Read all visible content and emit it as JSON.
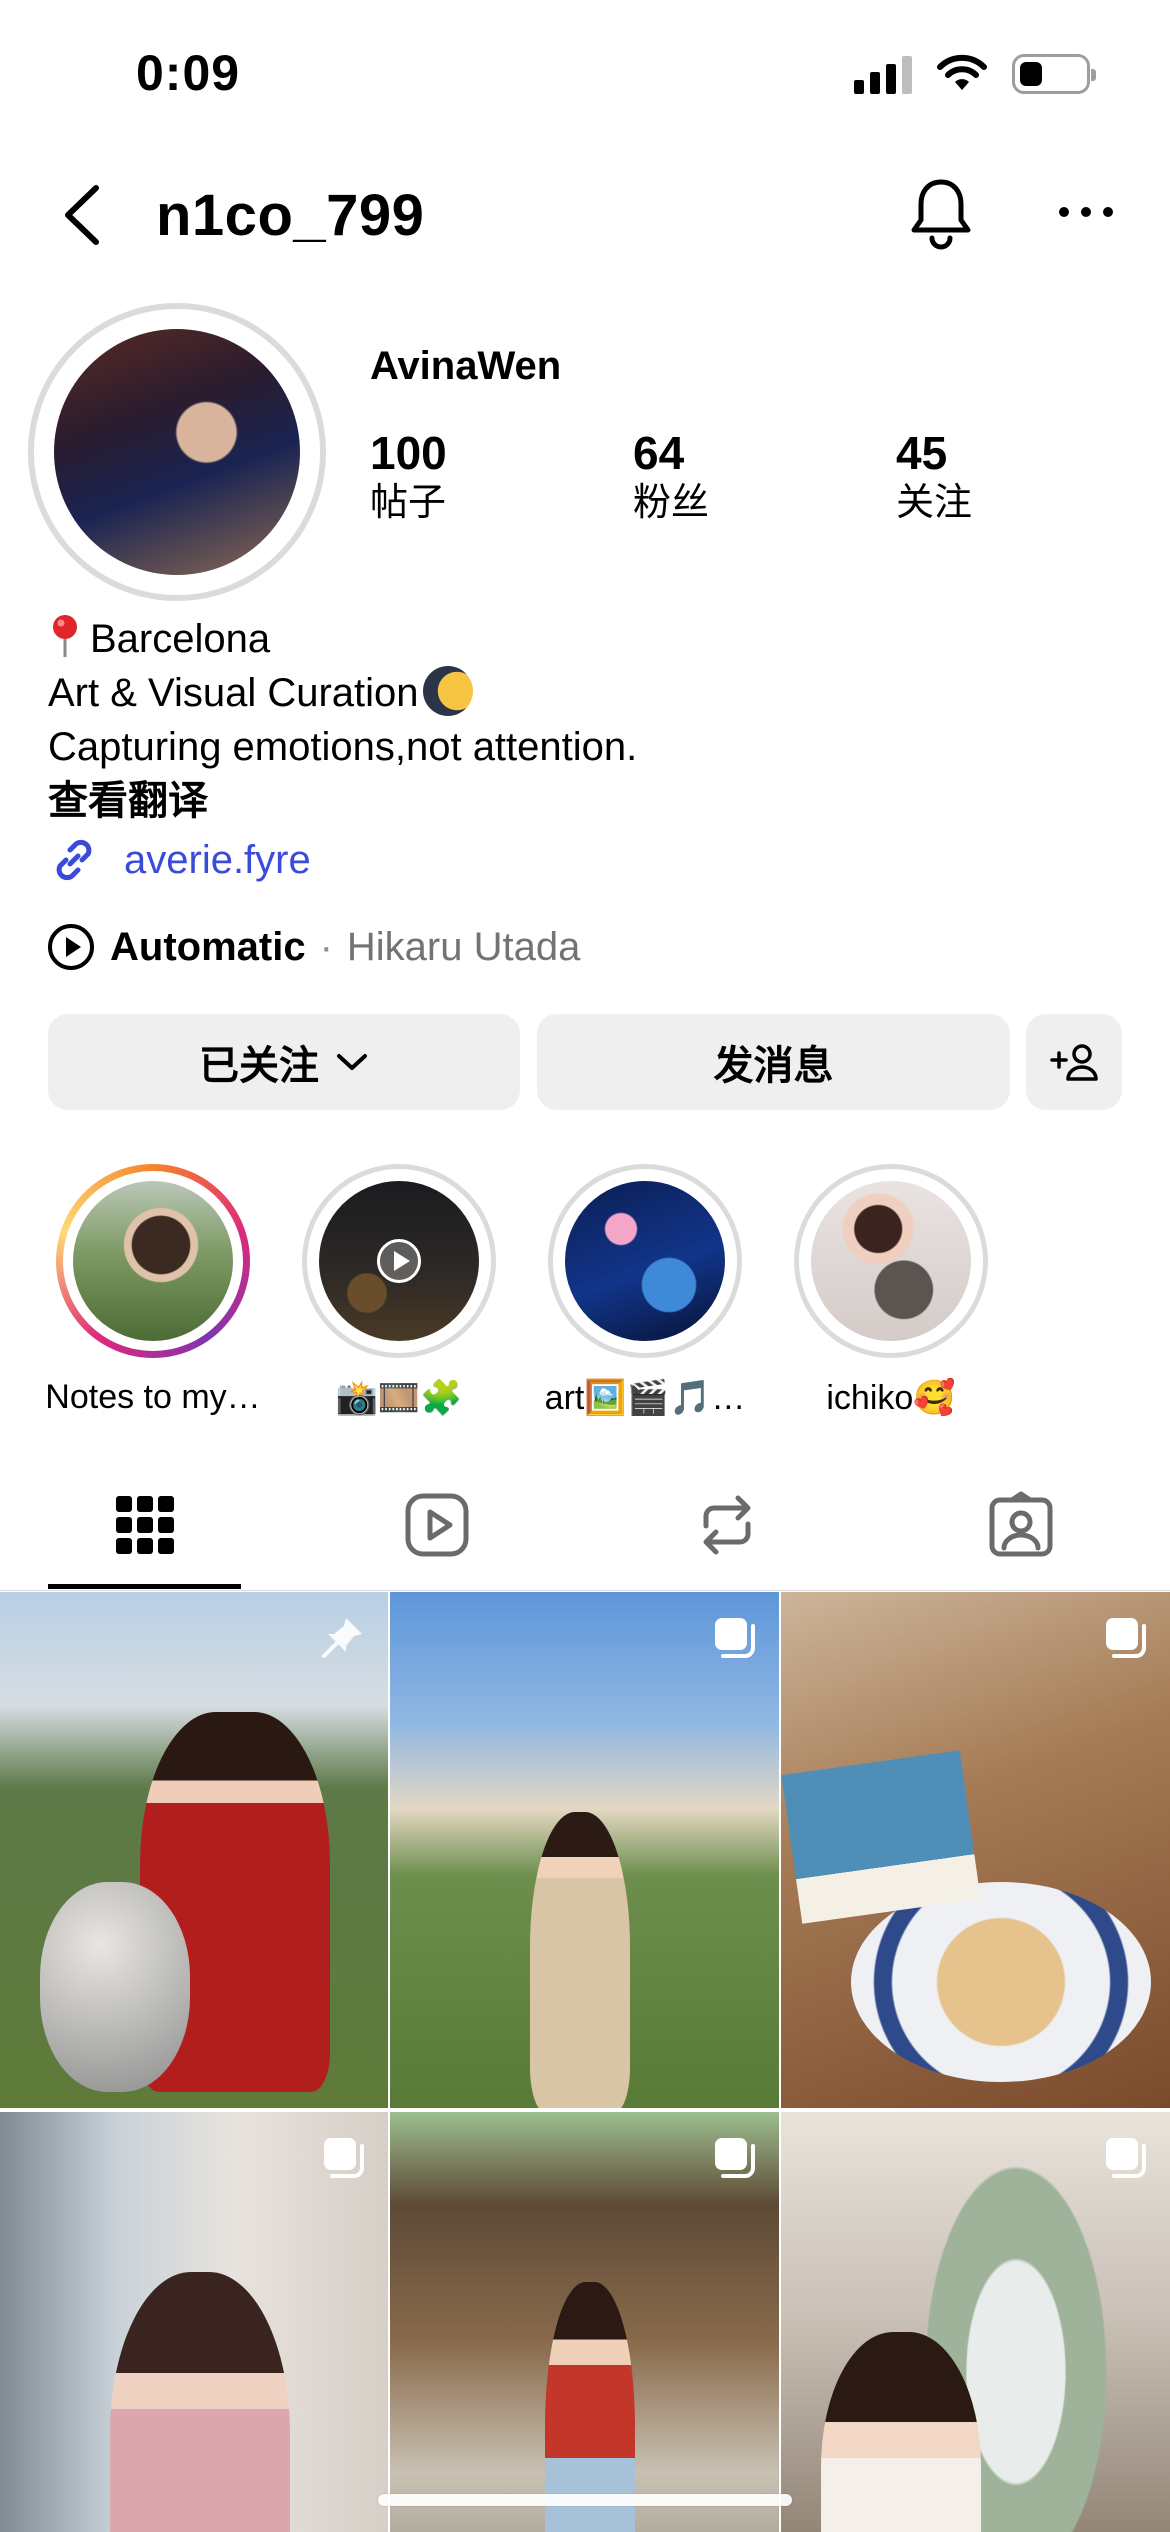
{
  "status_bar": {
    "time": "0:09"
  },
  "header": {
    "username": "n1co_799"
  },
  "profile": {
    "display_name": "AvinaWen",
    "stats": [
      {
        "value": "100",
        "label": "帖子"
      },
      {
        "value": "64",
        "label": "粉丝"
      },
      {
        "value": "45",
        "label": "关注"
      }
    ],
    "bio": {
      "location": "Barcelona",
      "line2": "Art & Visual Curation",
      "line3": "Capturing emotions,not attention.",
      "translate": "查看翻译"
    },
    "link": "averie.fyre",
    "music": {
      "title": "Automatic",
      "separator": "·",
      "artist": "Hikaru Utada"
    }
  },
  "actions": {
    "following_label": "已关注",
    "message_label": "发消息"
  },
  "highlights": [
    {
      "label": "Notes to my…",
      "style": "story"
    },
    {
      "label": "📸🎞️🧩"
    },
    {
      "label": "art🖼️🎬🎵…"
    },
    {
      "label": "ichiko🥰"
    }
  ],
  "tabs": [
    "grid-icon",
    "reels-icon",
    "reposts-icon",
    "tagged-icon"
  ],
  "posts": [
    {
      "badge": "pin-icon"
    },
    {
      "badge": "carousel-icon"
    },
    {
      "badge": "carousel-icon"
    },
    {
      "badge": "carousel-icon"
    },
    {
      "badge": "carousel-icon"
    },
    {
      "badge": "carousel-icon"
    }
  ],
  "colors": {
    "link": "#3b4bd9",
    "button_bg": "#efefef",
    "muted": "#737373"
  }
}
